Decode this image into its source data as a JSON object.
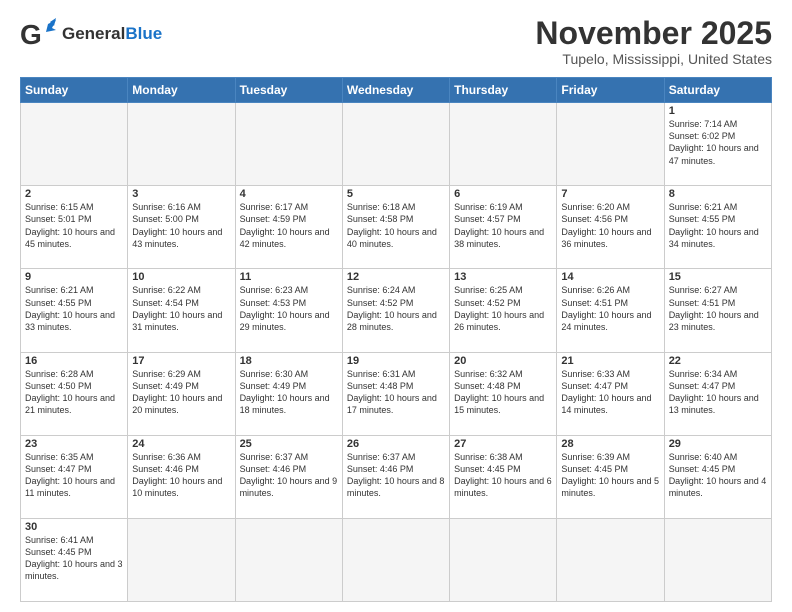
{
  "header": {
    "logo_general": "General",
    "logo_blue": "Blue",
    "title": "November 2025",
    "subtitle": "Tupelo, Mississippi, United States"
  },
  "days_of_week": [
    "Sunday",
    "Monday",
    "Tuesday",
    "Wednesday",
    "Thursday",
    "Friday",
    "Saturday"
  ],
  "weeks": [
    [
      {
        "day": "",
        "info": ""
      },
      {
        "day": "",
        "info": ""
      },
      {
        "day": "",
        "info": ""
      },
      {
        "day": "",
        "info": ""
      },
      {
        "day": "",
        "info": ""
      },
      {
        "day": "",
        "info": ""
      },
      {
        "day": "1",
        "info": "Sunrise: 7:14 AM\nSunset: 6:02 PM\nDaylight: 10 hours and 47 minutes."
      }
    ],
    [
      {
        "day": "2",
        "info": "Sunrise: 6:15 AM\nSunset: 5:01 PM\nDaylight: 10 hours and 45 minutes."
      },
      {
        "day": "3",
        "info": "Sunrise: 6:16 AM\nSunset: 5:00 PM\nDaylight: 10 hours and 43 minutes."
      },
      {
        "day": "4",
        "info": "Sunrise: 6:17 AM\nSunset: 4:59 PM\nDaylight: 10 hours and 42 minutes."
      },
      {
        "day": "5",
        "info": "Sunrise: 6:18 AM\nSunset: 4:58 PM\nDaylight: 10 hours and 40 minutes."
      },
      {
        "day": "6",
        "info": "Sunrise: 6:19 AM\nSunset: 4:57 PM\nDaylight: 10 hours and 38 minutes."
      },
      {
        "day": "7",
        "info": "Sunrise: 6:20 AM\nSunset: 4:56 PM\nDaylight: 10 hours and 36 minutes."
      },
      {
        "day": "8",
        "info": "Sunrise: 6:21 AM\nSunset: 4:55 PM\nDaylight: 10 hours and 34 minutes."
      }
    ],
    [
      {
        "day": "9",
        "info": "Sunrise: 6:21 AM\nSunset: 4:55 PM\nDaylight: 10 hours and 33 minutes."
      },
      {
        "day": "10",
        "info": "Sunrise: 6:22 AM\nSunset: 4:54 PM\nDaylight: 10 hours and 31 minutes."
      },
      {
        "day": "11",
        "info": "Sunrise: 6:23 AM\nSunset: 4:53 PM\nDaylight: 10 hours and 29 minutes."
      },
      {
        "day": "12",
        "info": "Sunrise: 6:24 AM\nSunset: 4:52 PM\nDaylight: 10 hours and 28 minutes."
      },
      {
        "day": "13",
        "info": "Sunrise: 6:25 AM\nSunset: 4:52 PM\nDaylight: 10 hours and 26 minutes."
      },
      {
        "day": "14",
        "info": "Sunrise: 6:26 AM\nSunset: 4:51 PM\nDaylight: 10 hours and 24 minutes."
      },
      {
        "day": "15",
        "info": "Sunrise: 6:27 AM\nSunset: 4:51 PM\nDaylight: 10 hours and 23 minutes."
      }
    ],
    [
      {
        "day": "16",
        "info": "Sunrise: 6:28 AM\nSunset: 4:50 PM\nDaylight: 10 hours and 21 minutes."
      },
      {
        "day": "17",
        "info": "Sunrise: 6:29 AM\nSunset: 4:49 PM\nDaylight: 10 hours and 20 minutes."
      },
      {
        "day": "18",
        "info": "Sunrise: 6:30 AM\nSunset: 4:49 PM\nDaylight: 10 hours and 18 minutes."
      },
      {
        "day": "19",
        "info": "Sunrise: 6:31 AM\nSunset: 4:48 PM\nDaylight: 10 hours and 17 minutes."
      },
      {
        "day": "20",
        "info": "Sunrise: 6:32 AM\nSunset: 4:48 PM\nDaylight: 10 hours and 15 minutes."
      },
      {
        "day": "21",
        "info": "Sunrise: 6:33 AM\nSunset: 4:47 PM\nDaylight: 10 hours and 14 minutes."
      },
      {
        "day": "22",
        "info": "Sunrise: 6:34 AM\nSunset: 4:47 PM\nDaylight: 10 hours and 13 minutes."
      }
    ],
    [
      {
        "day": "23",
        "info": "Sunrise: 6:35 AM\nSunset: 4:47 PM\nDaylight: 10 hours and 11 minutes."
      },
      {
        "day": "24",
        "info": "Sunrise: 6:36 AM\nSunset: 4:46 PM\nDaylight: 10 hours and 10 minutes."
      },
      {
        "day": "25",
        "info": "Sunrise: 6:37 AM\nSunset: 4:46 PM\nDaylight: 10 hours and 9 minutes."
      },
      {
        "day": "26",
        "info": "Sunrise: 6:37 AM\nSunset: 4:46 PM\nDaylight: 10 hours and 8 minutes."
      },
      {
        "day": "27",
        "info": "Sunrise: 6:38 AM\nSunset: 4:45 PM\nDaylight: 10 hours and 6 minutes."
      },
      {
        "day": "28",
        "info": "Sunrise: 6:39 AM\nSunset: 4:45 PM\nDaylight: 10 hours and 5 minutes."
      },
      {
        "day": "29",
        "info": "Sunrise: 6:40 AM\nSunset: 4:45 PM\nDaylight: 10 hours and 4 minutes."
      }
    ],
    [
      {
        "day": "30",
        "info": "Sunrise: 6:41 AM\nSunset: 4:45 PM\nDaylight: 10 hours and 3 minutes."
      },
      {
        "day": "",
        "info": ""
      },
      {
        "day": "",
        "info": ""
      },
      {
        "day": "",
        "info": ""
      },
      {
        "day": "",
        "info": ""
      },
      {
        "day": "",
        "info": ""
      },
      {
        "day": "",
        "info": ""
      }
    ]
  ]
}
